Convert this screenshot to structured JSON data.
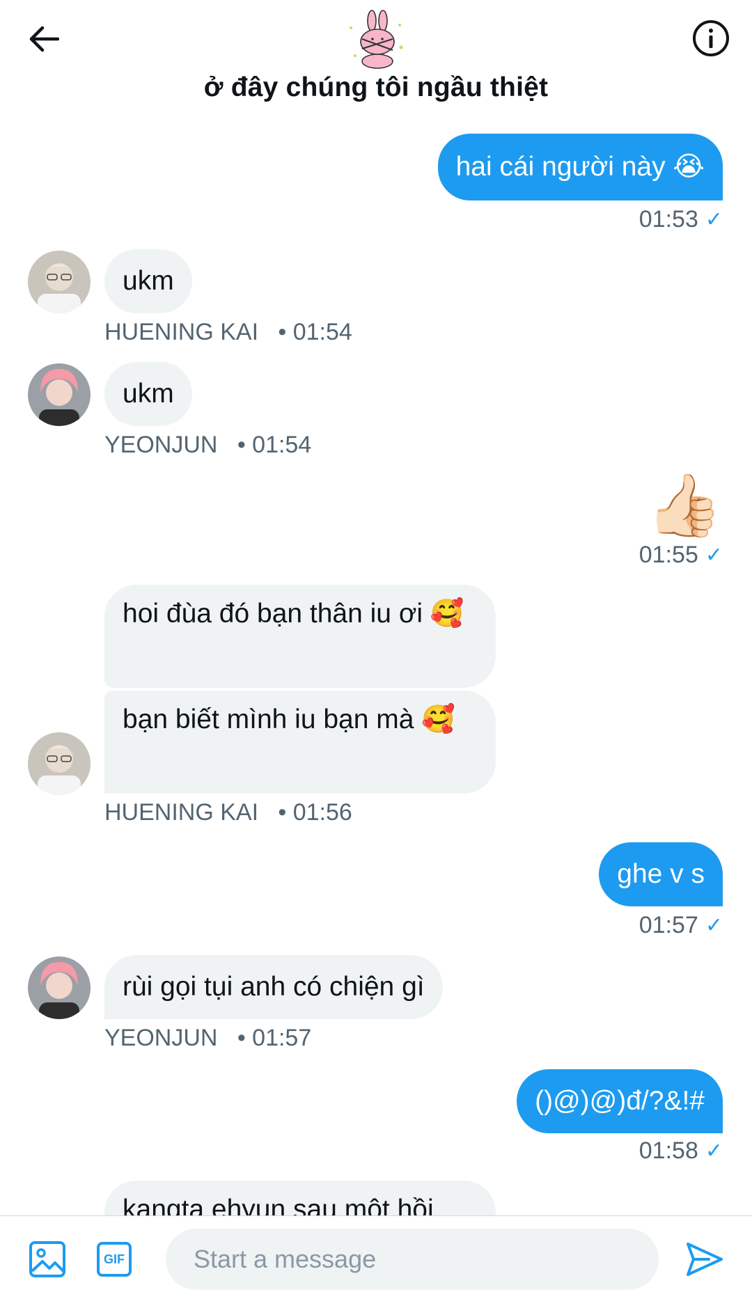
{
  "header": {
    "title": "ở đây chúng tôi ngầu thiệt",
    "back_icon": "arrow-left-icon",
    "info_icon": "info-icon"
  },
  "colors": {
    "accent": "#1d9bf0",
    "incoming_bubble": "#eff3f4",
    "meta_text": "#536471"
  },
  "messages": [
    {
      "dir": "out",
      "text": "hai cái người này 😭",
      "time": "01:53"
    },
    {
      "dir": "in",
      "text": "ukm",
      "sender": "HUENING KAI",
      "time": "• 01:54"
    },
    {
      "dir": "in",
      "text": "ukm",
      "sender": "YEONJUN",
      "time": "• 01:54"
    },
    {
      "dir": "out",
      "text": "👍🏻",
      "time": "01:55"
    },
    {
      "dir": "in",
      "text": "hoi đùa đó bạn thân iu ơi 🥰"
    },
    {
      "dir": "in",
      "text": "bạn biết mình iu bạn mà 🥰",
      "sender": "HUENING KAI",
      "time": "• 01:56"
    },
    {
      "dir": "out",
      "text": "ghe v s",
      "time": "01:57"
    },
    {
      "dir": "in",
      "text": "rùi gọi tụi anh có chiện gì",
      "sender": "YEONJUN",
      "time": "• 01:57"
    },
    {
      "dir": "out",
      "text": "()@)@)đ/?&!#",
      "time": "01:58"
    },
    {
      "dir": "in",
      "text": "kangta ehyun sau một hồi"
    }
  ],
  "composer": {
    "placeholder": "Start a message",
    "image_icon": "image-icon",
    "gif_label": "GIF",
    "send_icon": "send-icon"
  }
}
